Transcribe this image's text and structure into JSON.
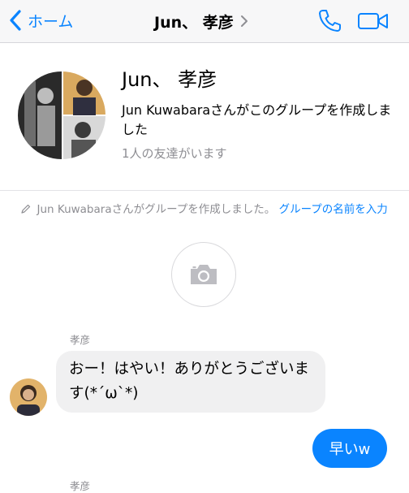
{
  "nav": {
    "back_label": "ホーム",
    "title": "Jun、 孝彦",
    "accent_color": "#0a84ff"
  },
  "group": {
    "name": "Jun、 孝彦",
    "description": "Jun Kuwabaraさんがこのグループを作成しました",
    "friend_count": "1人の友達がいます"
  },
  "system_message": {
    "text": "Jun Kuwabaraさんがグループを作成しました。",
    "link": "グループの名前を入力"
  },
  "messages": [
    {
      "sender": "孝彦",
      "text": "おー！はやい！ありがとうございます(*´ω`*)",
      "direction": "incoming"
    },
    {
      "text": "早いw",
      "direction": "outgoing"
    },
    {
      "sender": "孝彦"
    }
  ]
}
